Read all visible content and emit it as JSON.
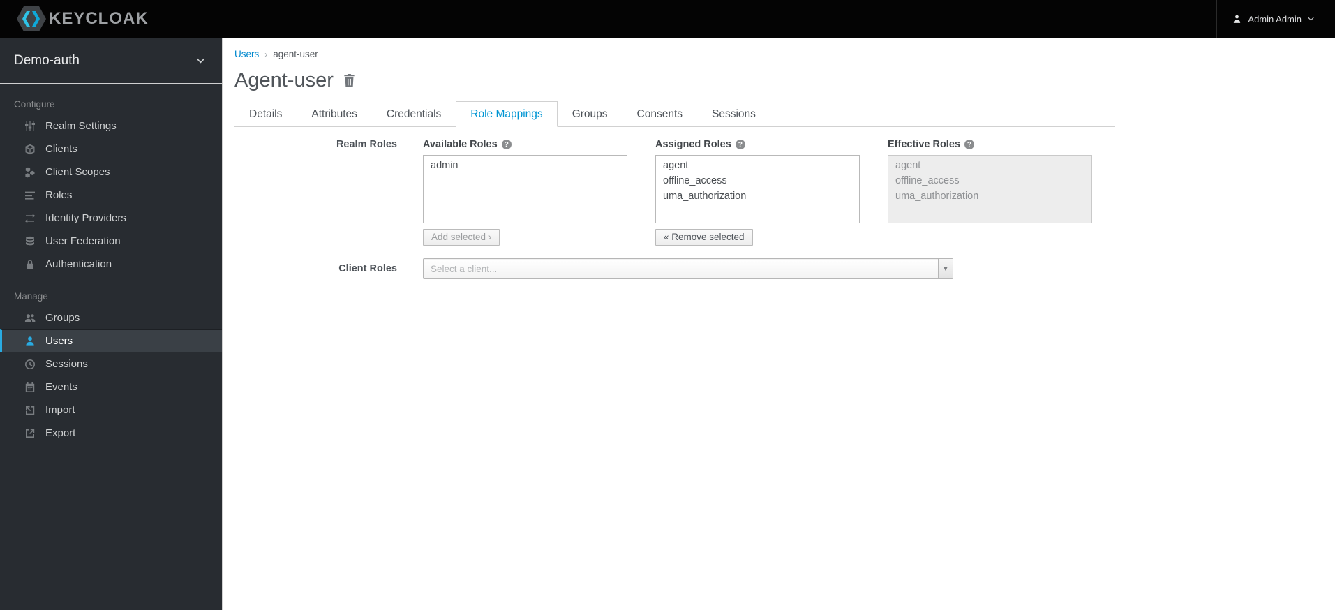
{
  "topbar": {
    "brand": "KEYCLOAK",
    "user_label": "Admin Admin"
  },
  "sidebar": {
    "realm": "Demo-auth",
    "sections": [
      {
        "label": "Configure",
        "items": [
          {
            "label": "Realm Settings"
          },
          {
            "label": "Clients"
          },
          {
            "label": "Client Scopes"
          },
          {
            "label": "Roles"
          },
          {
            "label": "Identity Providers"
          },
          {
            "label": "User Federation"
          },
          {
            "label": "Authentication"
          }
        ]
      },
      {
        "label": "Manage",
        "items": [
          {
            "label": "Groups"
          },
          {
            "label": "Users",
            "active": true
          },
          {
            "label": "Sessions"
          },
          {
            "label": "Events"
          },
          {
            "label": "Import"
          },
          {
            "label": "Export"
          }
        ]
      }
    ]
  },
  "breadcrumb": {
    "link": "Users",
    "separator": "›",
    "current": "agent-user"
  },
  "page": {
    "title": "Agent-user"
  },
  "tabs": [
    {
      "label": "Details"
    },
    {
      "label": "Attributes"
    },
    {
      "label": "Credentials"
    },
    {
      "label": "Role Mappings",
      "active": true
    },
    {
      "label": "Groups"
    },
    {
      "label": "Consents"
    },
    {
      "label": "Sessions"
    }
  ],
  "role_mappings": {
    "realm_roles_label": "Realm Roles",
    "client_roles_label": "Client Roles",
    "help_glyph": "?",
    "available": {
      "header": "Available Roles",
      "items": [
        "admin"
      ]
    },
    "assigned": {
      "header": "Assigned Roles",
      "items": [
        "agent",
        "offline_access",
        "uma_authorization"
      ]
    },
    "effective": {
      "header": "Effective Roles",
      "items": [
        "agent",
        "offline_access",
        "uma_authorization"
      ]
    },
    "add_button": "Add selected ›",
    "remove_button": "« Remove selected",
    "client_select_placeholder": "Select a client..."
  },
  "colors": {
    "topbar_bg": "#040404",
    "sidebar_bg": "#282c31",
    "accent_cyan": "#29abe2",
    "link_blue": "#0088ce",
    "active_tab_blue": "#0095d3"
  }
}
